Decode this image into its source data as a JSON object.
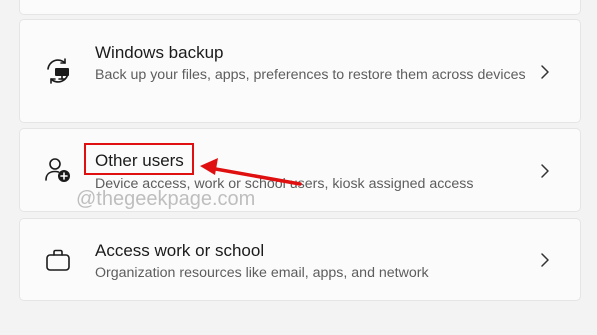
{
  "settings": {
    "items": [
      {
        "title": "Windows backup",
        "description": "Back up your files, apps, preferences to restore them across devices",
        "icon": "backup-sync-icon"
      },
      {
        "title": "Other users",
        "description": "Device access, work or school users, kiosk assigned access",
        "icon": "add-user-icon"
      },
      {
        "title": "Access work or school",
        "description": "Organization resources like email, apps, and network",
        "icon": "briefcase-icon"
      }
    ]
  },
  "annotation": {
    "watermark": "@thegeekpage.com",
    "highlight_color": "#e01010"
  },
  "colors": {
    "background": "#f3f3f3",
    "card": "#fbfbfb",
    "title_text": "#1b1b1b",
    "desc_text": "#5d5d5d"
  }
}
